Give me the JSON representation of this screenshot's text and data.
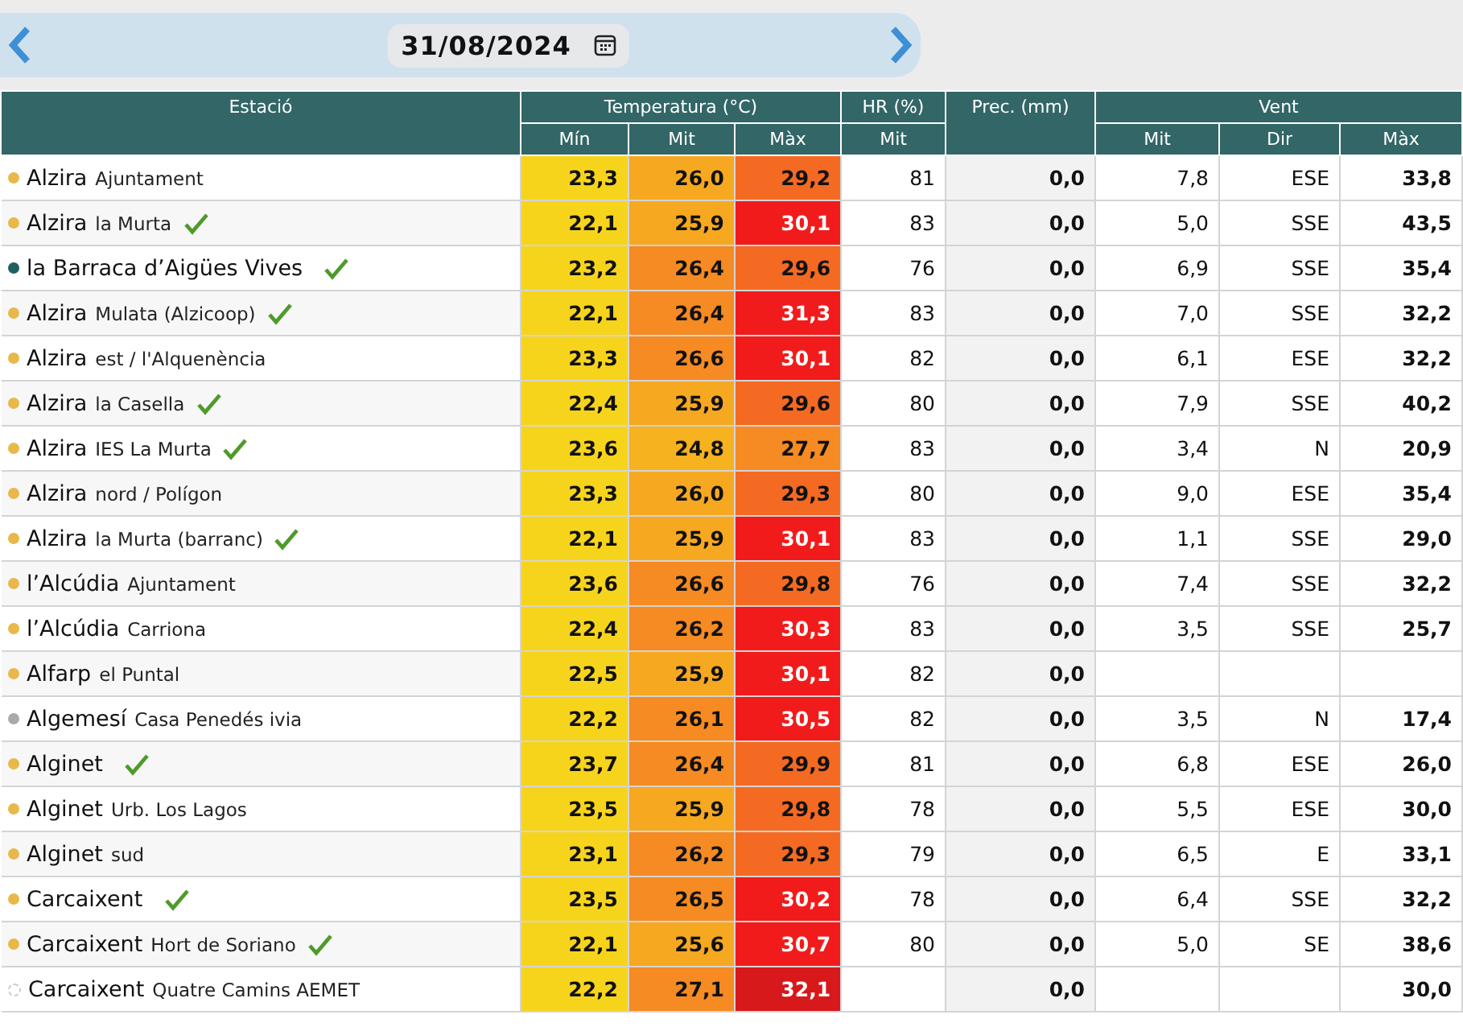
{
  "date_bar": {
    "date": "31/08/2024"
  },
  "table": {
    "groups": [
      "Estació",
      "Temperatura (°C)",
      "HR (%)",
      "Prec. (mm)",
      "Vent"
    ],
    "subheaders": [
      "Mín",
      "Mit",
      "Màx",
      "Mit",
      "Mit",
      "Dir",
      "Màx"
    ],
    "rows": [
      {
        "town": "Alzira",
        "place": "Ajuntament",
        "dot": {
          "color": "#e8b84a",
          "hollow": false
        },
        "verified": false,
        "temp": [
          {
            "value": "23,3",
            "color": "#f7d41c"
          },
          {
            "value": "26,0",
            "color": "#f6a821"
          },
          {
            "value": "29,2",
            "color": "#f46a22"
          }
        ],
        "hr": "81",
        "prec": "0,0",
        "wind": {
          "mit": "7,8",
          "dir": "ESE",
          "max": "33,8"
        }
      },
      {
        "town": "Alzira",
        "place": "la Murta",
        "dot": {
          "color": "#e8b84a",
          "hollow": false
        },
        "verified": true,
        "temp": [
          {
            "value": "22,1",
            "color": "#f7d41c"
          },
          {
            "value": "25,9",
            "color": "#f6a821"
          },
          {
            "value": "30,1",
            "color": "#f21b1b"
          }
        ],
        "hr": "83",
        "prec": "0,0",
        "wind": {
          "mit": "5,0",
          "dir": "SSE",
          "max": "43,5"
        }
      },
      {
        "town": "la Barraca d’Aigües Vives",
        "dot": {
          "color": "#1f5f5f",
          "hollow": false
        },
        "verified": true,
        "temp": [
          {
            "value": "23,2",
            "color": "#f7d41c"
          },
          {
            "value": "26,4",
            "color": "#f58b22"
          },
          {
            "value": "29,6",
            "color": "#f46a22"
          }
        ],
        "hr": "76",
        "prec": "0,0",
        "wind": {
          "mit": "6,9",
          "dir": "SSE",
          "max": "35,4"
        }
      },
      {
        "town": "Alzira",
        "place": "Mulata (Alzicoop)",
        "dot": {
          "color": "#e8b84a",
          "hollow": false
        },
        "verified": true,
        "temp": [
          {
            "value": "22,1",
            "color": "#f7d41c"
          },
          {
            "value": "26,4",
            "color": "#f58b22"
          },
          {
            "value": "31,3",
            "color": "#f21b1b"
          }
        ],
        "hr": "83",
        "prec": "0,0",
        "wind": {
          "mit": "7,0",
          "dir": "SSE",
          "max": "32,2"
        }
      },
      {
        "town": "Alzira",
        "place": "est / l'Alquenència",
        "dot": {
          "color": "#e8b84a",
          "hollow": false
        },
        "verified": false,
        "temp": [
          {
            "value": "23,3",
            "color": "#f7d41c"
          },
          {
            "value": "26,6",
            "color": "#f58b22"
          },
          {
            "value": "30,1",
            "color": "#f21b1b"
          }
        ],
        "hr": "82",
        "prec": "0,0",
        "wind": {
          "mit": "6,1",
          "dir": "ESE",
          "max": "32,2"
        }
      },
      {
        "town": "Alzira",
        "place": "la Casella",
        "dot": {
          "color": "#e8b84a",
          "hollow": false
        },
        "verified": true,
        "temp": [
          {
            "value": "22,4",
            "color": "#f7d41c"
          },
          {
            "value": "25,9",
            "color": "#f6a821"
          },
          {
            "value": "29,6",
            "color": "#f46a22"
          }
        ],
        "hr": "80",
        "prec": "0,0",
        "wind": {
          "mit": "7,9",
          "dir": "SSE",
          "max": "40,2"
        }
      },
      {
        "town": "Alzira",
        "place": "IES La Murta",
        "dot": {
          "color": "#e8b84a",
          "hollow": false
        },
        "verified": true,
        "temp": [
          {
            "value": "23,6",
            "color": "#f7d41c"
          },
          {
            "value": "24,8",
            "color": "#f6b21f"
          },
          {
            "value": "27,7",
            "color": "#f58b22"
          }
        ],
        "hr": "83",
        "prec": "0,0",
        "wind": {
          "mit": "3,4",
          "dir": "N",
          "max": "20,9"
        }
      },
      {
        "town": "Alzira",
        "place": "nord / Polígon",
        "dot": {
          "color": "#e8b84a",
          "hollow": false
        },
        "verified": false,
        "temp": [
          {
            "value": "23,3",
            "color": "#f7d41c"
          },
          {
            "value": "26,0",
            "color": "#f6a821"
          },
          {
            "value": "29,3",
            "color": "#f46a22"
          }
        ],
        "hr": "80",
        "prec": "0,0",
        "wind": {
          "mit": "9,0",
          "dir": "ESE",
          "max": "35,4"
        }
      },
      {
        "town": "Alzira",
        "place": "la Murta (barranc)",
        "dot": {
          "color": "#e8b84a",
          "hollow": false
        },
        "verified": true,
        "temp": [
          {
            "value": "22,1",
            "color": "#f7d41c"
          },
          {
            "value": "25,9",
            "color": "#f6a821"
          },
          {
            "value": "30,1",
            "color": "#f21b1b"
          }
        ],
        "hr": "83",
        "prec": "0,0",
        "wind": {
          "mit": "1,1",
          "dir": "SSE",
          "max": "29,0"
        }
      },
      {
        "town": "l’Alcúdia",
        "place": "Ajuntament",
        "dot": {
          "color": "#e8b84a",
          "hollow": false
        },
        "verified": false,
        "temp": [
          {
            "value": "23,6",
            "color": "#f7d41c"
          },
          {
            "value": "26,6",
            "color": "#f58b22"
          },
          {
            "value": "29,8",
            "color": "#f46a22"
          }
        ],
        "hr": "76",
        "prec": "0,0",
        "wind": {
          "mit": "7,4",
          "dir": "SSE",
          "max": "32,2"
        }
      },
      {
        "town": "l’Alcúdia",
        "place": "Carriona",
        "dot": {
          "color": "#e8b84a",
          "hollow": false
        },
        "verified": false,
        "temp": [
          {
            "value": "22,4",
            "color": "#f7d41c"
          },
          {
            "value": "26,2",
            "color": "#f58b22"
          },
          {
            "value": "30,3",
            "color": "#f21b1b"
          }
        ],
        "hr": "83",
        "prec": "0,0",
        "wind": {
          "mit": "3,5",
          "dir": "SSE",
          "max": "25,7"
        }
      },
      {
        "town": "Alfarp",
        "place": "el Puntal",
        "dot": {
          "color": "#e8b84a",
          "hollow": false
        },
        "verified": false,
        "temp": [
          {
            "value": "22,5",
            "color": "#f7d41c"
          },
          {
            "value": "25,9",
            "color": "#f6a821"
          },
          {
            "value": "30,1",
            "color": "#f21b1b"
          }
        ],
        "hr": "82",
        "prec": "0,0",
        "wind": {}
      },
      {
        "town": "Algemesí",
        "place": "Casa Penedés ivia",
        "dot": {
          "color": "#aaaaaa",
          "hollow": false
        },
        "verified": false,
        "temp": [
          {
            "value": "22,2",
            "color": "#f7d41c"
          },
          {
            "value": "26,1",
            "color": "#f58b22"
          },
          {
            "value": "30,5",
            "color": "#f21b1b"
          }
        ],
        "hr": "82",
        "prec": "0,0",
        "wind": {
          "mit": "3,5",
          "dir": "N",
          "max": "17,4"
        }
      },
      {
        "town": "Alginet",
        "dot": {
          "color": "#e8b84a",
          "hollow": false
        },
        "verified": true,
        "temp": [
          {
            "value": "23,7",
            "color": "#f7d41c"
          },
          {
            "value": "26,4",
            "color": "#f58b22"
          },
          {
            "value": "29,9",
            "color": "#f46a22"
          }
        ],
        "hr": "81",
        "prec": "0,0",
        "wind": {
          "mit": "6,8",
          "dir": "ESE",
          "max": "26,0"
        }
      },
      {
        "town": "Alginet",
        "place": "Urb. Los Lagos",
        "dot": {
          "color": "#e8b84a",
          "hollow": false
        },
        "verified": false,
        "temp": [
          {
            "value": "23,5",
            "color": "#f7d41c"
          },
          {
            "value": "25,9",
            "color": "#f6a821"
          },
          {
            "value": "29,8",
            "color": "#f46a22"
          }
        ],
        "hr": "78",
        "prec": "0,0",
        "wind": {
          "mit": "5,5",
          "dir": "ESE",
          "max": "30,0"
        }
      },
      {
        "town": "Alginet",
        "place": "sud",
        "dot": {
          "color": "#e8b84a",
          "hollow": false
        },
        "verified": false,
        "temp": [
          {
            "value": "23,1",
            "color": "#f7d41c"
          },
          {
            "value": "26,2",
            "color": "#f58b22"
          },
          {
            "value": "29,3",
            "color": "#f46a22"
          }
        ],
        "hr": "79",
        "prec": "0,0",
        "wind": {
          "mit": "6,5",
          "dir": "E",
          "max": "33,1"
        }
      },
      {
        "town": "Carcaixent",
        "dot": {
          "color": "#e8b84a",
          "hollow": false
        },
        "verified": true,
        "temp": [
          {
            "value": "23,5",
            "color": "#f7d41c"
          },
          {
            "value": "26,5",
            "color": "#f58b22"
          },
          {
            "value": "30,2",
            "color": "#f21b1b"
          }
        ],
        "hr": "78",
        "prec": "0,0",
        "wind": {
          "mit": "6,4",
          "dir": "SSE",
          "max": "32,2"
        }
      },
      {
        "town": "Carcaixent",
        "place": "Hort de Soriano",
        "dot": {
          "color": "#e8b84a",
          "hollow": false
        },
        "verified": true,
        "temp": [
          {
            "value": "22,1",
            "color": "#f7d41c"
          },
          {
            "value": "25,6",
            "color": "#f6a821"
          },
          {
            "value": "30,7",
            "color": "#f21b1b"
          }
        ],
        "hr": "80",
        "prec": "0,0",
        "wind": {
          "mit": "5,0",
          "dir": "SE",
          "max": "38,6"
        }
      },
      {
        "town": "Carcaixent",
        "place": "Quatre Camins AEMET",
        "dot": {
          "color": "#cccccc",
          "hollow": true
        },
        "verified": false,
        "temp": [
          {
            "value": "22,2",
            "color": "#f7d41c"
          },
          {
            "value": "27,1",
            "color": "#f58b22"
          },
          {
            "value": "32,1",
            "color": "#d7191c"
          }
        ],
        "prec": "0,0",
        "wind": {
          "max": "30,0"
        }
      }
    ]
  }
}
